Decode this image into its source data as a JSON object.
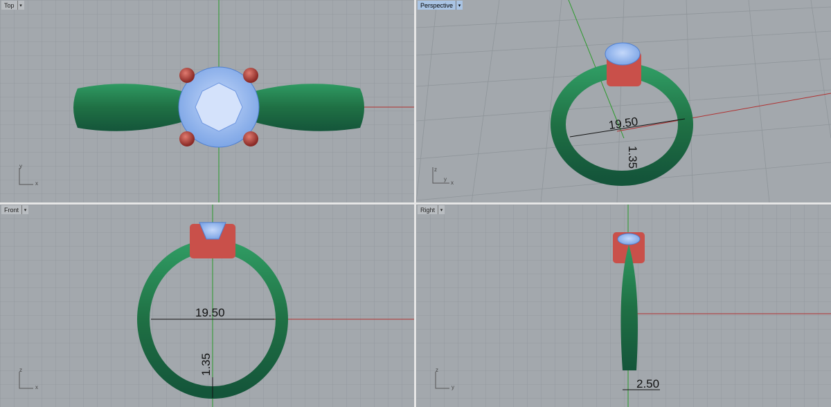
{
  "viewports": [
    {
      "name": "Top",
      "active": false,
      "axes": [
        "y",
        "x"
      ]
    },
    {
      "name": "Perspective",
      "active": true,
      "axes": [
        "z",
        "y",
        "x"
      ],
      "dimensions": [
        "19.50",
        "1.35"
      ]
    },
    {
      "name": "Front",
      "active": false,
      "axes": [
        "z",
        "x"
      ],
      "dimensions": [
        "19.50",
        "1.35"
      ]
    },
    {
      "name": "Right",
      "active": false,
      "axes": [
        "z",
        "y"
      ],
      "dimensions": [
        "2.50"
      ]
    }
  ],
  "colors": {
    "background": "#a3a8ad",
    "grid": "#8f959a",
    "band": "#22784a",
    "prongs": "#c9504a",
    "stone": "#8fb4ee",
    "x_axis": "#b03030",
    "y_axis": "#2a9a2a"
  },
  "icons": {
    "dropdown": "dropdown-arrow-icon"
  }
}
